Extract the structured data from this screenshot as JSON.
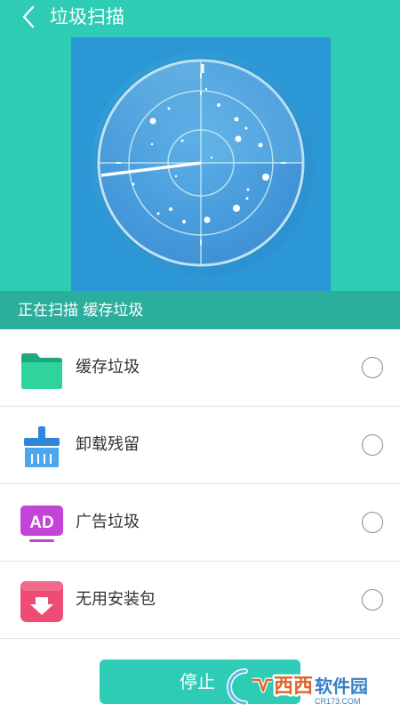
{
  "header": {
    "title": "垃圾扫描",
    "back_icon": "chevron-left-icon"
  },
  "status": {
    "text": "正在扫描 缓存垃圾"
  },
  "list": {
    "items": [
      {
        "label": "缓存垃圾",
        "icon": "folder-icon"
      },
      {
        "label": "卸载残留",
        "icon": "broom-icon"
      },
      {
        "label": "广告垃圾",
        "icon": "ad-icon"
      },
      {
        "label": "无用安装包",
        "icon": "package-download-icon"
      }
    ]
  },
  "button": {
    "stop_label": "停止"
  },
  "watermark": {
    "brand": "西西软件园",
    "site": "CR173.COM"
  },
  "colors": {
    "accent": "#2ecbb5",
    "status_bar": "#2bae9b",
    "radar_bg": "#2b97d4"
  }
}
